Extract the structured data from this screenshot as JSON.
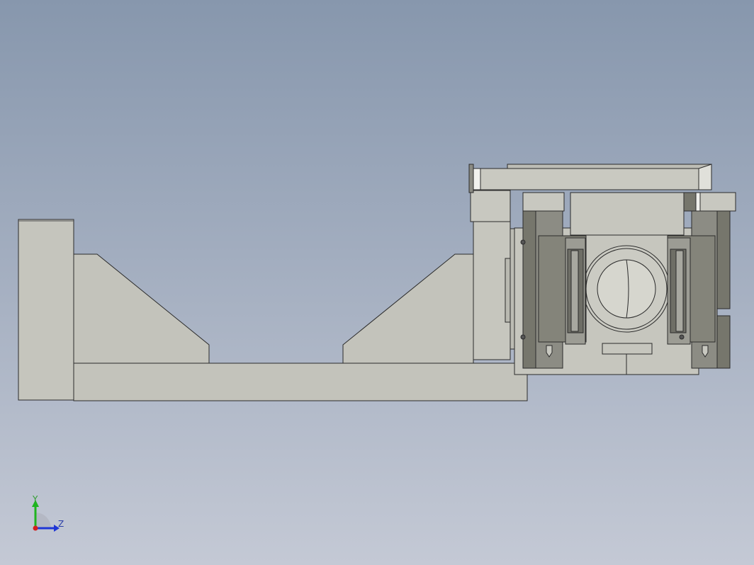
{
  "view": {
    "background_top": "#8797ad",
    "background_bottom": "#c4c9d5",
    "part_fill": "#c3c3bb",
    "part_edge": "#2b2b2b",
    "dark_part_fill": "#7a7a70"
  },
  "triad": {
    "y_label": "Y",
    "z_label": "Z",
    "y_color": "#1fb41f",
    "z_color": "#1f36d6",
    "x_color": "#d41f1f"
  }
}
